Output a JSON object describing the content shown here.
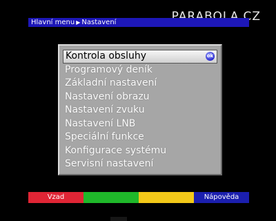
{
  "watermark": "PARABOLA.CZ",
  "breadcrumb": {
    "root": "Hlavní menu",
    "current": "Nastavení"
  },
  "menu": {
    "selected_index": 0,
    "ok_label": "ok",
    "items": [
      "Kontrola obsluhy",
      "Programový deník",
      "Základní nastavení",
      "Nastavení obrazu",
      "Nastavení zvuku",
      "Nastavení LNB",
      "Speciální funkce",
      "Konfigurace systému",
      "Servisní nastavení"
    ]
  },
  "buttons": {
    "red": "Vzad",
    "green": "",
    "yellow": "",
    "blue": "Nápověda"
  },
  "colors": {
    "background": "#000000",
    "breadcrumb_bar": "#1d17b8",
    "panel": "#a6a6a6",
    "red": "#e02535",
    "green": "#1fb82a",
    "yellow": "#f3c919",
    "blue": "#1b1fae"
  }
}
